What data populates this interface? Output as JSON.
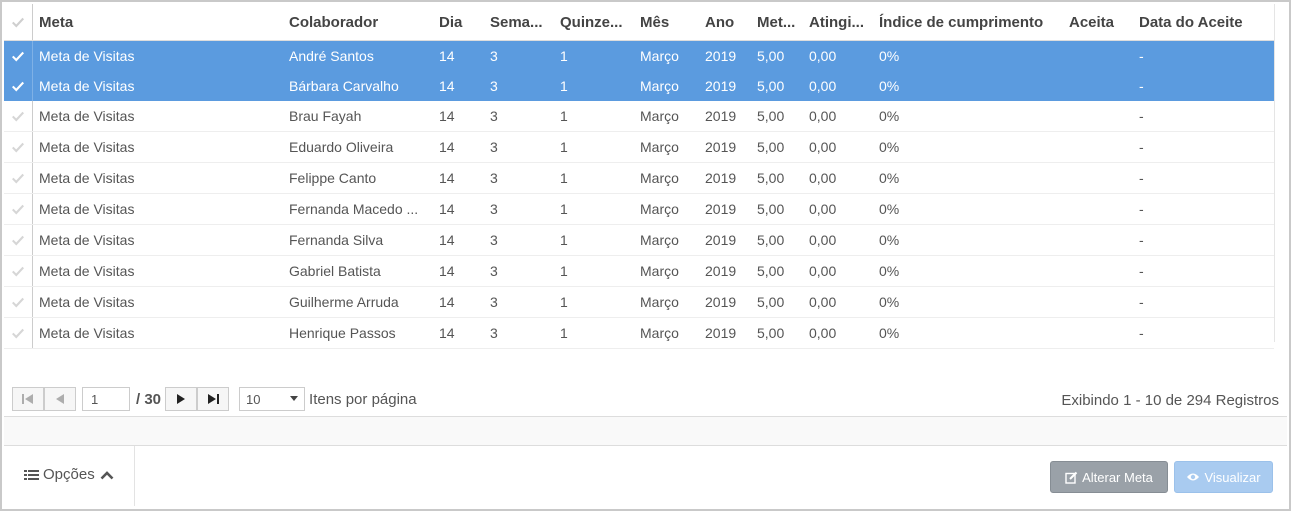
{
  "columns": [
    "Meta",
    "Colaborador",
    "Dia",
    "Sema...",
    "Quinze...",
    "Mês",
    "Ano",
    "Met...",
    "Atingi...",
    "Índice de cumprimento",
    "Aceita",
    "Data do Aceite"
  ],
  "rows": [
    {
      "selected": true,
      "cells": [
        "Meta de Visitas",
        "André Santos",
        "14",
        "3",
        "1",
        "Março",
        "2019",
        "5,00",
        "0,00",
        "0%",
        "",
        "-"
      ]
    },
    {
      "selected": true,
      "cells": [
        "Meta de Visitas",
        "Bárbara Carvalho",
        "14",
        "3",
        "1",
        "Março",
        "2019",
        "5,00",
        "0,00",
        "0%",
        "",
        "-"
      ]
    },
    {
      "selected": false,
      "cells": [
        "Meta de Visitas",
        "Brau Fayah",
        "14",
        "3",
        "1",
        "Março",
        "2019",
        "5,00",
        "0,00",
        "0%",
        "",
        "-"
      ]
    },
    {
      "selected": false,
      "cells": [
        "Meta de Visitas",
        "Eduardo Oliveira",
        "14",
        "3",
        "1",
        "Março",
        "2019",
        "5,00",
        "0,00",
        "0%",
        "",
        "-"
      ]
    },
    {
      "selected": false,
      "cells": [
        "Meta de Visitas",
        "Felippe Canto",
        "14",
        "3",
        "1",
        "Março",
        "2019",
        "5,00",
        "0,00",
        "0%",
        "",
        "-"
      ]
    },
    {
      "selected": false,
      "cells": [
        "Meta de Visitas",
        "Fernanda Macedo ...",
        "14",
        "3",
        "1",
        "Março",
        "2019",
        "5,00",
        "0,00",
        "0%",
        "",
        "-"
      ]
    },
    {
      "selected": false,
      "cells": [
        "Meta de Visitas",
        "Fernanda Silva",
        "14",
        "3",
        "1",
        "Março",
        "2019",
        "5,00",
        "0,00",
        "0%",
        "",
        "-"
      ]
    },
    {
      "selected": false,
      "cells": [
        "Meta de Visitas",
        "Gabriel Batista",
        "14",
        "3",
        "1",
        "Março",
        "2019",
        "5,00",
        "0,00",
        "0%",
        "",
        "-"
      ]
    },
    {
      "selected": false,
      "cells": [
        "Meta de Visitas",
        "Guilherme Arruda",
        "14",
        "3",
        "1",
        "Março",
        "2019",
        "5,00",
        "0,00",
        "0%",
        "",
        "-"
      ]
    },
    {
      "selected": false,
      "cells": [
        "Meta de Visitas",
        "Henrique Passos",
        "14",
        "3",
        "1",
        "Março",
        "2019",
        "5,00",
        "0,00",
        "0%",
        "",
        "-"
      ]
    }
  ],
  "pager": {
    "page_value": "1",
    "total_pages": "/ 30",
    "page_size": "10",
    "items_label": "Itens por página",
    "info": "Exibindo 1 - 10 de 294 Registros"
  },
  "footer": {
    "options_label": "Opções",
    "alter_label": "Alterar Meta",
    "view_label": "Visualizar"
  },
  "colors": {
    "selected_row": "#5b9bdf",
    "alter_button": "#9aa1a8",
    "view_button": "#a9cbf0"
  },
  "icons": [
    "check-icon",
    "first-page-icon",
    "prev-page-icon",
    "next-page-icon",
    "last-page-icon",
    "caret-down-icon",
    "list-icon",
    "chevron-up-icon",
    "edit-icon",
    "eye-icon"
  ]
}
